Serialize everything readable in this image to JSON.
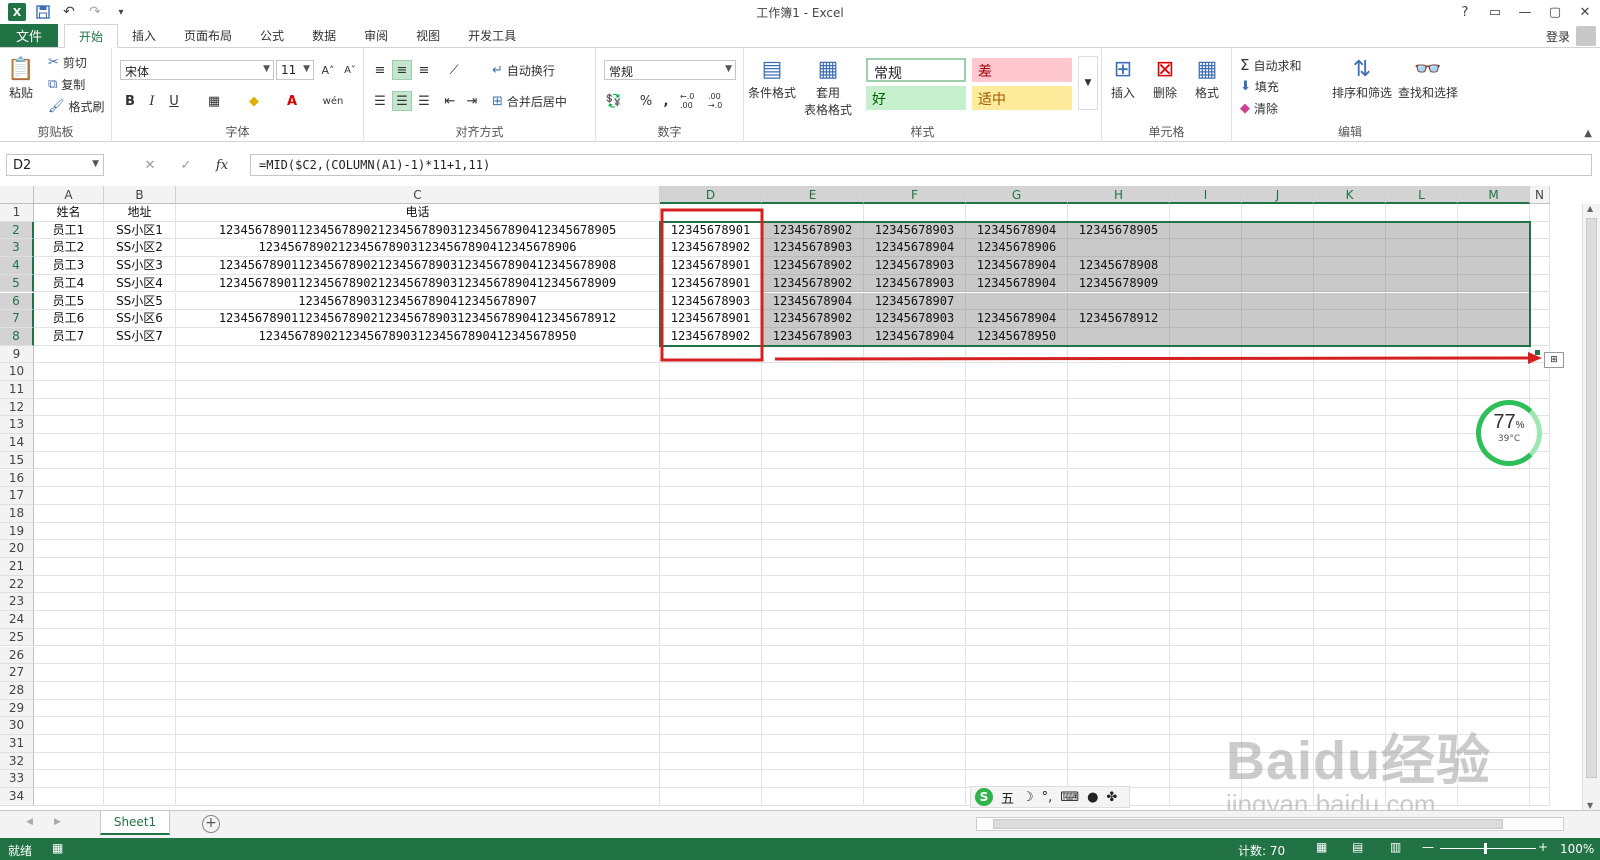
{
  "window": {
    "title": "工作簿1 - Excel"
  },
  "quick_access": {
    "save": "save-icon",
    "undo": "undo-icon",
    "redo": "redo-icon"
  },
  "win_controls": {
    "help": "?",
    "restore_ribbon": "▭",
    "minimize": "—",
    "maximize": "▢",
    "close": "✕"
  },
  "ribbon": {
    "tabs": [
      "文件",
      "开始",
      "插入",
      "页面布局",
      "公式",
      "数据",
      "审阅",
      "视图",
      "开发工具"
    ],
    "active_tab": "开始",
    "login": "登录",
    "clipboard": {
      "paste": "粘贴",
      "cut": "剪切",
      "copy": "复制",
      "format_painter": "格式刷",
      "label": "剪贴板"
    },
    "font": {
      "name": "宋体",
      "size": "11",
      "bold": "B",
      "italic": "I",
      "underline": "U",
      "grow": "A˄",
      "shrink": "A˅",
      "phonetic": "wén",
      "label": "字体"
    },
    "alignment": {
      "wrap": "自动换行",
      "merge": "合并后居中",
      "label": "对齐方式"
    },
    "number": {
      "format": "常规",
      "percent": "%",
      "comma": ",",
      "inc_dec": "←.0 .00",
      "dec_dec": ".00 →.0",
      "label": "数字"
    },
    "styles": {
      "conditional": "条件格式",
      "table_fmt_1": "套用",
      "table_fmt_2": "表格格式",
      "normal": "常规",
      "bad": "差",
      "good": "好",
      "neutral": "适中",
      "label": "样式"
    },
    "cells": {
      "insert": "插入",
      "delete": "删除",
      "format": "格式",
      "label": "单元格"
    },
    "editing": {
      "autosum": "自动求和",
      "fill": "填充",
      "clear": "清除",
      "sort": "排序和筛选",
      "find": "查找和选择",
      "label": "编辑"
    }
  },
  "formula_bar": {
    "name_box": "D2",
    "cancel": "✕",
    "enter": "✓",
    "fx": "fx",
    "formula": "=MID($C2,(COLUMN(A1)-1)*11+1,11)"
  },
  "columns": [
    "A",
    "B",
    "C",
    "D",
    "E",
    "F",
    "G",
    "H",
    "I",
    "J",
    "K",
    "L",
    "M",
    "N"
  ],
  "rows": [
    "1",
    "2",
    "3",
    "4",
    "5",
    "6",
    "7",
    "8",
    "9",
    "10",
    "11",
    "12",
    "13",
    "14",
    "15",
    "16",
    "17",
    "18",
    "19",
    "20",
    "21",
    "22",
    "23",
    "24",
    "25",
    "26",
    "27",
    "28",
    "29",
    "30",
    "31",
    "32",
    "33",
    "34"
  ],
  "table": {
    "headers": [
      "姓名",
      "地址",
      "电话"
    ],
    "data": [
      [
        "员工1",
        "SS小区1",
        "1234567890112345678902123456789031234567890412345678905",
        "12345678901",
        "12345678902",
        "12345678903",
        "12345678904",
        "12345678905"
      ],
      [
        "员工2",
        "SS小区2",
        "12345678902123456789031234567890412345678906",
        "12345678902",
        "12345678903",
        "12345678904",
        "12345678906",
        ""
      ],
      [
        "员工3",
        "SS小区3",
        "1234567890112345678902123456789031234567890412345678908",
        "12345678901",
        "12345678902",
        "12345678903",
        "12345678904",
        "12345678908"
      ],
      [
        "员工4",
        "SS小区4",
        "1234567890112345678902123456789031234567890412345678909",
        "12345678901",
        "12345678902",
        "12345678903",
        "12345678904",
        "12345678909"
      ],
      [
        "员工5",
        "SS小区5",
        "123456789031234567890412345678907",
        "12345678903",
        "12345678904",
        "12345678907",
        "",
        ""
      ],
      [
        "员工6",
        "SS小区6",
        "1234567890112345678902123456789031234567890412345678912",
        "12345678901",
        "12345678902",
        "12345678903",
        "12345678904",
        "12345678912"
      ],
      [
        "员工7",
        "SS小区7",
        "12345678902123456789031234567890412345678950",
        "12345678902",
        "12345678903",
        "12345678904",
        "12345678950",
        ""
      ]
    ]
  },
  "sheets": {
    "active": "Sheet1",
    "add": "+"
  },
  "status": {
    "ready": "就绪",
    "count": "计数: 70",
    "zoom": "100%"
  },
  "widget": {
    "percent": "77",
    "pct_sign": "%",
    "temp": "39°C"
  },
  "ime": {
    "mode": "五"
  },
  "watermark": {
    "brand": "Baidu经验",
    "url": "jingyan.baidu.com"
  },
  "colors": {
    "accent": "#217346",
    "selection": "#c9c9c9",
    "annotation": "#d42020",
    "widget": "#2fbf5a"
  }
}
